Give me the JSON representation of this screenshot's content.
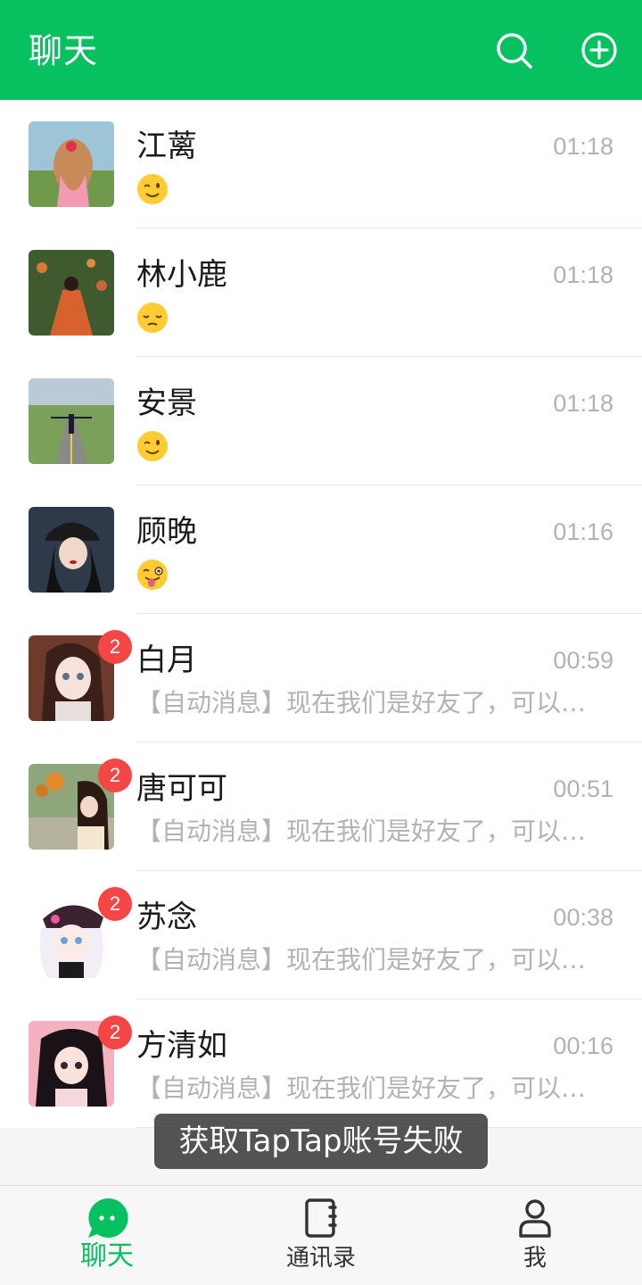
{
  "colors": {
    "brand": "#07c160",
    "badge": "#f54545",
    "muted_text": "#b2b2b2"
  },
  "header": {
    "title": "聊天",
    "search_icon": "search-icon",
    "add_icon": "plus-circle-icon"
  },
  "chats": [
    {
      "name": "江蓠",
      "time": "01:18",
      "preview_emoji": "winking-face",
      "badge": null
    },
    {
      "name": "林小鹿",
      "time": "01:18",
      "preview_emoji": "pensive-face",
      "badge": null
    },
    {
      "name": "安景",
      "time": "01:18",
      "preview_emoji": "winking-face",
      "badge": null
    },
    {
      "name": "顾晚",
      "time": "01:16",
      "preview_emoji": "winking-tongue-face",
      "badge": null
    },
    {
      "name": "白月",
      "time": "00:59",
      "preview": "【自动消息】现在我们是好友了，可以开始聊天了",
      "badge": "2"
    },
    {
      "name": "唐可可",
      "time": "00:51",
      "preview": "【自动消息】现在我们是好友了，可以开始聊天了",
      "badge": "2"
    },
    {
      "name": "苏念",
      "time": "00:38",
      "preview": "【自动消息】现在我们是好友了，可以开始聊天了",
      "badge": "2"
    },
    {
      "name": "方清如",
      "time": "00:16",
      "preview": "【自动消息】现在我们是好友了，可以开始聊天了",
      "badge": "2"
    }
  ],
  "toast": "获取TapTap账号失败",
  "tabs": [
    {
      "label": "聊天",
      "icon": "chat-bubble-icon",
      "active": true
    },
    {
      "label": "通讯录",
      "icon": "contacts-book-icon",
      "active": false
    },
    {
      "label": "我",
      "icon": "person-icon",
      "active": false
    }
  ]
}
